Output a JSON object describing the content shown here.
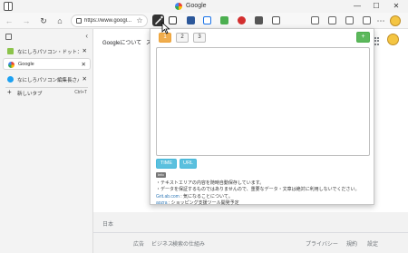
{
  "window": {
    "title": "Google",
    "minimize_glyph": "—",
    "maximize_glyph": "☐",
    "close_glyph": "✕"
  },
  "toolbar": {
    "back_glyph": "←",
    "forward_glyph": "→",
    "refresh_glyph": "↻",
    "home_glyph": "⌂",
    "url": "https://www.googl...",
    "favorites_glyph": "☆",
    "menu_glyph": "⋯",
    "extension_icons": [
      "memo-extension-icon",
      "window-icon",
      "save-icon",
      "translate-icon",
      "image-icon",
      "extension-red-icon",
      "grid-icon",
      "box-icon",
      "puzzle-icon",
      "collections-icon",
      "favorites-bar-icon",
      "profile-icon"
    ]
  },
  "sidebar": {
    "collapse_glyph": "‹",
    "tabs": [
      {
        "label": "なにしろパソコン・ドットコム | マルチ",
        "close": "✕",
        "favicon_color": "#8bc34a"
      },
      {
        "label": "Google",
        "close": "✕",
        "favicon_color": "#4285f4",
        "active": true
      },
      {
        "label": "なにしろパソコン編集長さん (@72all",
        "close": "✕",
        "favicon_color": "#1da1f2"
      }
    ],
    "new_tab": {
      "label": "新しいタブ",
      "shortcut": "Ctrl+T",
      "glyph": "+"
    }
  },
  "page": {
    "header_links": [
      "Googleについて",
      "ス"
    ],
    "footer": {
      "country": "日本",
      "links_left": [
        "広告",
        "ビジネス",
        "検索の仕組み"
      ],
      "links_right": [
        "プライバシー",
        "規約",
        "設定"
      ]
    }
  },
  "popup": {
    "tabs": [
      "1",
      "2",
      "3"
    ],
    "active_tab": "1",
    "add_label": "+",
    "textarea_value": "",
    "buttons": {
      "time": "TIME",
      "url": "URL"
    },
    "info_badge": "Info",
    "notes": [
      "・テキストエリアの内容を随時自動保存しています。",
      "・データを保証するものではありませんので、重要なデータ・文章は絶対に利用しないでください。"
    ],
    "links": [
      {
        "text": "Grit.ab.com",
        "rest": " : 気になることについて。"
      },
      {
        "text": "aozra",
        "rest": " : ショッピング支援ツール開発予定"
      }
    ]
  }
}
